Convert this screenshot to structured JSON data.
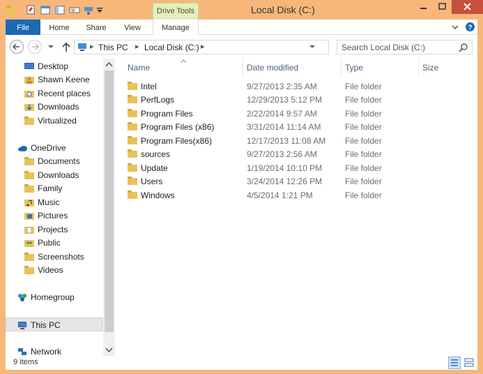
{
  "window": {
    "title": "Local Disk (C:)",
    "contextual_tab": "Drive Tools",
    "accent_color": "#1a6ab4",
    "frame_color": "#f7b77a"
  },
  "ribbon": {
    "tabs": [
      {
        "label": "File"
      },
      {
        "label": "Home"
      },
      {
        "label": "Share"
      },
      {
        "label": "View"
      },
      {
        "label": "Manage"
      }
    ]
  },
  "address": {
    "crumbs": [
      "This PC",
      "Local Disk (C:)"
    ],
    "search_placeholder": "Search Local Disk (C:)"
  },
  "nav": {
    "items": [
      {
        "label": "Desktop",
        "icon": "desktop-icon"
      },
      {
        "label": "Shawn Keene",
        "icon": "user-folder-icon"
      },
      {
        "label": "Recent places",
        "icon": "recent-places-icon"
      },
      {
        "label": "Downloads",
        "icon": "downloads-icon"
      },
      {
        "label": "Virtualized",
        "icon": "folder-icon"
      },
      {
        "label": "OneDrive",
        "icon": "onedrive-icon"
      },
      {
        "label": "Documents",
        "icon": "folder-icon"
      },
      {
        "label": "Downloads",
        "icon": "folder-icon"
      },
      {
        "label": "Family",
        "icon": "folder-icon"
      },
      {
        "label": "Music",
        "icon": "music-folder-icon"
      },
      {
        "label": "Pictures",
        "icon": "pictures-folder-icon"
      },
      {
        "label": "Projects",
        "icon": "documents-folder-icon"
      },
      {
        "label": "Public",
        "icon": "public-folder-icon"
      },
      {
        "label": "Screenshots",
        "icon": "folder-icon"
      },
      {
        "label": "Videos",
        "icon": "folder-icon"
      },
      {
        "label": "Homegroup",
        "icon": "homegroup-icon"
      },
      {
        "label": "This PC",
        "icon": "this-pc-icon"
      },
      {
        "label": "Network",
        "icon": "network-icon"
      }
    ]
  },
  "files": {
    "columns": [
      "Name",
      "Date modified",
      "Type",
      "Size"
    ],
    "rows": [
      {
        "name": "Intel",
        "date": "9/27/2013 2:35 AM",
        "type": "File folder"
      },
      {
        "name": "PerfLogs",
        "date": "12/29/2013 5:12 PM",
        "type": "File folder"
      },
      {
        "name": "Program Files",
        "date": "2/22/2014 9:57 AM",
        "type": "File folder"
      },
      {
        "name": "Program Files (x86)",
        "date": "3/31/2014 11:14 AM",
        "type": "File folder"
      },
      {
        "name": "Program Files(x86)",
        "date": "12/17/2013 11:08 AM",
        "type": "File folder"
      },
      {
        "name": "sources",
        "date": "9/27/2013 2:56 AM",
        "type": "File folder"
      },
      {
        "name": "Update",
        "date": "1/19/2014 10:10 PM",
        "type": "File folder"
      },
      {
        "name": "Users",
        "date": "3/24/2014 12:26 PM",
        "type": "File folder"
      },
      {
        "name": "Windows",
        "date": "4/5/2014 1:21 PM",
        "type": "File folder"
      }
    ]
  },
  "status": {
    "item_count": "9 items"
  }
}
